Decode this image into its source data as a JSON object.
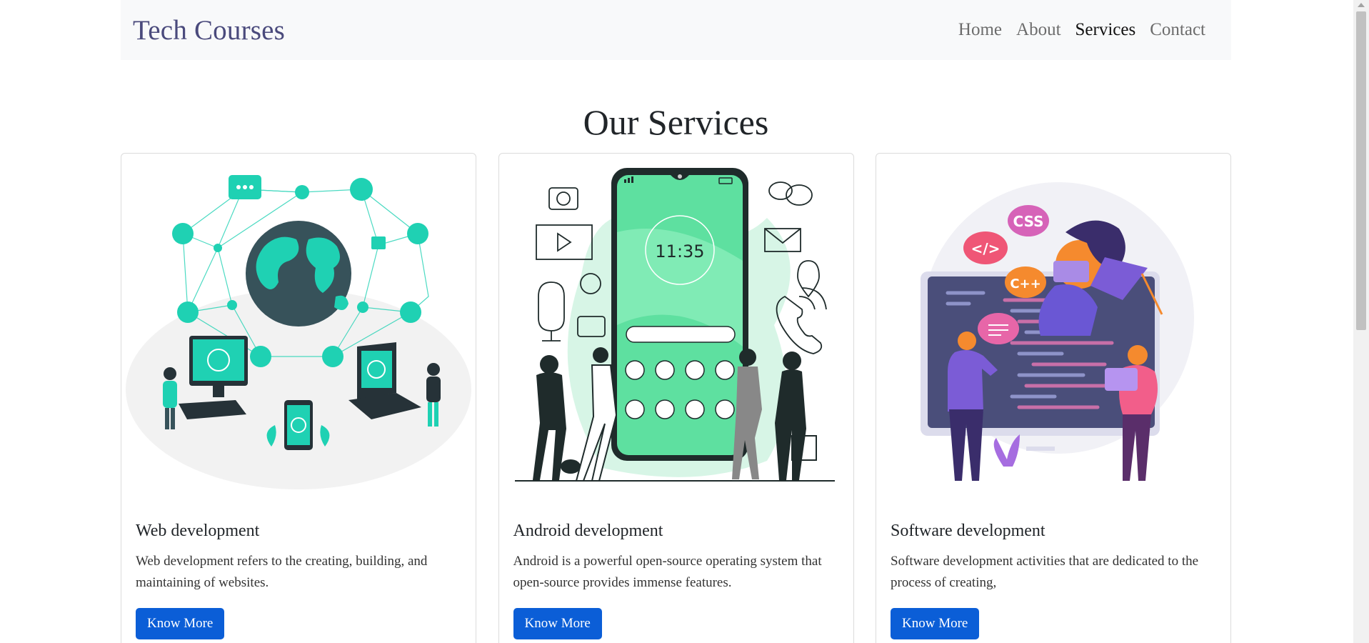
{
  "navbar": {
    "brand": "Tech Courses",
    "links": [
      {
        "label": "Home",
        "active": false
      },
      {
        "label": "About",
        "active": false
      },
      {
        "label": "Services",
        "active": true
      },
      {
        "label": "Contact",
        "active": false
      }
    ]
  },
  "services": {
    "title": "Our Services",
    "cards": [
      {
        "title": "Web development",
        "text": "Web development refers to the creating, building, and maintaining of websites.",
        "button": "Know More",
        "illustration": "web-network-illustration"
      },
      {
        "title": "Android development",
        "text": "Android is a powerful open-source operating system that open-source provides immense features.",
        "button": "Know More",
        "illustration": "phone-people-illustration",
        "phone_time": "11:35"
      },
      {
        "title": "Software development",
        "text": "Software development activities that are dedicated to the process of creating,",
        "button": "Know More",
        "illustration": "code-screen-illustration",
        "badges": [
          "CSS",
          "</>",
          "C++"
        ]
      }
    ]
  },
  "colors": {
    "accent_teal": "#1fd1b3",
    "accent_green": "#5ee0a0",
    "accent_purple": "#7b5cd6",
    "button_blue": "#0b5ed7"
  }
}
